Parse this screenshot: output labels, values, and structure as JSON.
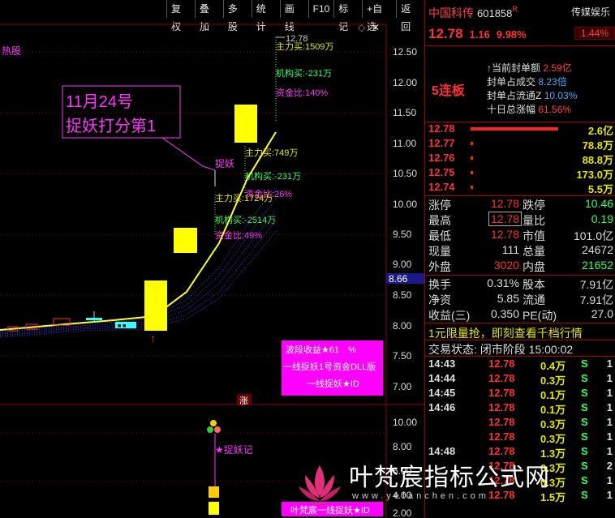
{
  "toolbar": {
    "buttons": [
      "复权",
      "叠加",
      "多股",
      "统计",
      "画线",
      "F10",
      "标记",
      "+自选",
      "返回"
    ]
  },
  "chart": {
    "hot_label": "热股",
    "annotation_box": {
      "line1": "11月24号",
      "line2": "捉妖打分第1"
    },
    "zhuoyao_label": "捉妖",
    "zhuoyao_ji_label": "★捉妖记",
    "current_price_tag": "8.66",
    "zhang_marker": "涨",
    "diamond_icon": "◇",
    "top_price_label": "12.78",
    "y_axis_main": [
      "12.50",
      "12.00",
      "11.50",
      "11.00",
      "10.50",
      "10.00",
      "9.50",
      "9.00",
      "8.50",
      "8.00",
      "7.50",
      "7.00"
    ],
    "y_axis_sub": [
      "10.00",
      "8.00",
      "6.00",
      "4.00",
      "2.00"
    ],
    "flow_top": {
      "main": "主力买:1509万",
      "inst": "机构买:-231万",
      "ratio": "资金比:140%"
    },
    "flow_mid": {
      "main": "主力买:749万",
      "inst": "机构买:-231万",
      "ratio": "资金比:26%"
    },
    "flow_low": {
      "main": "主力买:1724万",
      "inst": "机构买:-2514万",
      "ratio": "资金比:49%"
    },
    "magenta_panel": {
      "line1": "波段收益★61　%",
      "line2": "一线捉妖1号资金DLL版",
      "line3": "一线捉妖★ID"
    },
    "bottom_label": "叶梵宸一线捉妖★ID",
    "colors": {
      "bg": "#000000",
      "up_bar": "#ffff00",
      "ma": "#ffff33",
      "ribbon": "#3b3bff",
      "magenta": "#ff00ff",
      "grid": "#8b0000"
    }
  },
  "panel": {
    "name": "中国科传",
    "code": "601858",
    "r_flag": "R",
    "sector": "传媒娱乐",
    "sector_pct": "1.44%",
    "price": "12.78",
    "change": "1.16",
    "change_pct": "9.98%",
    "lianban": "5连板",
    "seal": [
      {
        "label": "当前封单额",
        "value": "2.59亿",
        "arrow": "↑"
      },
      {
        "label": "封单占成交",
        "value": "8.23倍"
      },
      {
        "label": "封单占流通Z",
        "value": "10.03%"
      },
      {
        "label": "十日总涨幅",
        "value": "61.56%"
      }
    ],
    "order_book": [
      {
        "price": "12.78",
        "vol": "2.6亿",
        "bar": 1.0
      },
      {
        "price": "12.77",
        "vol": "78.8万",
        "bar": 0.02
      },
      {
        "price": "12.76",
        "vol": "88.8万",
        "bar": 0.02
      },
      {
        "price": "12.75",
        "vol": "173.0万",
        "bar": 0.02
      },
      {
        "price": "12.74",
        "vol": "5.5万",
        "bar": 0.01
      }
    ],
    "stats": {
      "zhangting_l": "涨停",
      "zhangting_v": "12.78",
      "dieting_l": "跌停",
      "dieting_v": "10.46",
      "zuigao_l": "最高",
      "zuigao_v": "12.78",
      "liangbi_l": "量比",
      "liangbi_v": "0.19",
      "zuidi_l": "最低",
      "zuidi_v": "12.78",
      "shizhi_l": "市值",
      "shizhi_v": "101.0亿",
      "xianliang_l": "现量",
      "xianliang_v": "111",
      "zongliang_l": "总量",
      "zongliang_v": "24672",
      "waipan_l": "外盘",
      "waipan_v": "3020",
      "neipan_l": "内盘",
      "neipan_v": "21652",
      "huanshou_l": "换手",
      "huanshou_v": "0.31%",
      "guben_l": "股本",
      "guben_v": "7.91亿",
      "jingzi_l": "净资",
      "jingzi_v": "5.85",
      "liutong_l": "流通",
      "liutong_v": "7.91亿",
      "shouyi_l": "收益(三)",
      "shouyi_v": "0.350",
      "pe_l": "PE(动)",
      "pe_v": "27.0"
    },
    "promo": "1元限量抢，即刻查看千档行情",
    "trade_status": "交易状态: 闭市阶段 15:00:02",
    "ticks": [
      {
        "time": "14:43",
        "price": "12.78",
        "vol": "0.4万",
        "dir": "S",
        "cnt": "1"
      },
      {
        "time": "14:44",
        "price": "12.78",
        "vol": "0.3万",
        "dir": "S",
        "cnt": "1"
      },
      {
        "time": "14:45",
        "price": "12.78",
        "vol": "0.1万",
        "dir": "S",
        "cnt": "1"
      },
      {
        "time": "14:46",
        "price": "12.78",
        "vol": "0.1万",
        "dir": "S",
        "cnt": "1"
      },
      {
        "time": "",
        "price": "12.78",
        "vol": "0.3万",
        "dir": "S",
        "cnt": "1"
      },
      {
        "time": "",
        "price": "12.78",
        "vol": "0.3万",
        "dir": "S",
        "cnt": "1"
      },
      {
        "time": "14:48",
        "price": "12.78",
        "vol": "1.3万",
        "dir": "S",
        "cnt": "1"
      },
      {
        "time": "",
        "price": "12.78",
        "vol": "0.3万",
        "dir": "S",
        "cnt": "2"
      },
      {
        "time": "",
        "price": "12.78",
        "vol": "0.3万",
        "dir": "S",
        "cnt": "1"
      },
      {
        "time": "",
        "price": "12.78",
        "vol": "1.5万",
        "dir": "S",
        "cnt": "1"
      }
    ]
  },
  "watermark": {
    "text": "叶梵宸指标公式网",
    "url": "www.yefanchen.com"
  }
}
